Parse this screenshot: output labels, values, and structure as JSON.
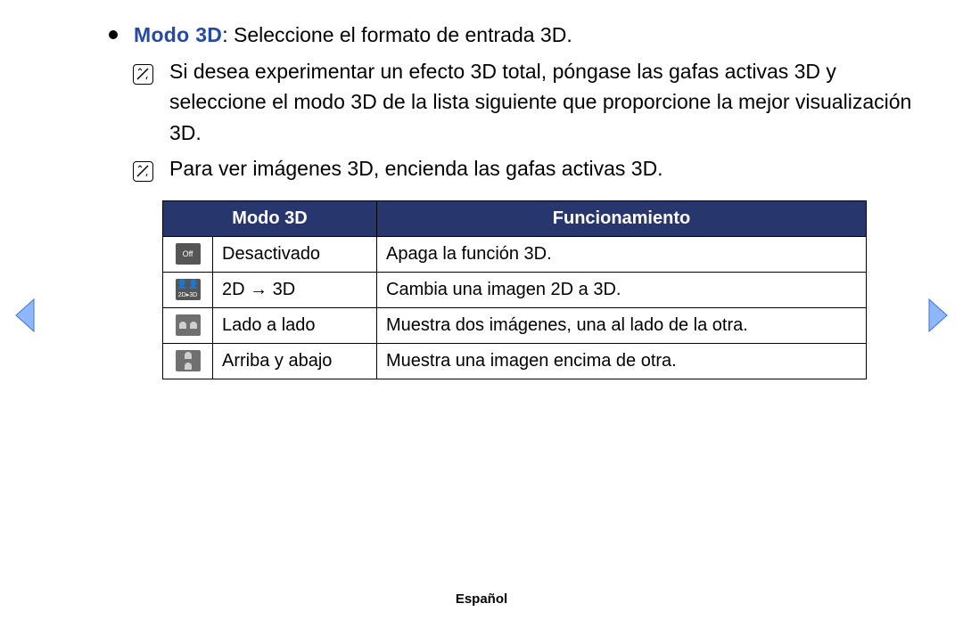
{
  "heading": {
    "term": "Modo 3D",
    "rest": ": Seleccione el formato de entrada 3D."
  },
  "notes": [
    "Si desea experimentar un efecto 3D total, póngase las gafas activas 3D y seleccione el modo 3D de la lista siguiente que proporcione la mejor visualización 3D.",
    "Para ver imágenes 3D, encienda las gafas activas 3D."
  ],
  "table": {
    "head_mode": "Modo 3D",
    "head_op": "Funcionamiento",
    "rows": [
      {
        "icon_label": "Off",
        "mode": "Desactivado",
        "op": "Apaga la función 3D."
      },
      {
        "icon_label": "2D→3D",
        "mode": "2D → 3D",
        "op": "Cambia una imagen 2D a 3D."
      },
      {
        "icon_label": "side-by-side",
        "mode": "Lado a lado",
        "op": "Muestra dos imágenes, una al lado de la otra."
      },
      {
        "icon_label": "top-bottom",
        "mode": "Arriba y abajo",
        "op": "Muestra una imagen encima de otra."
      }
    ]
  },
  "footer": "Español"
}
